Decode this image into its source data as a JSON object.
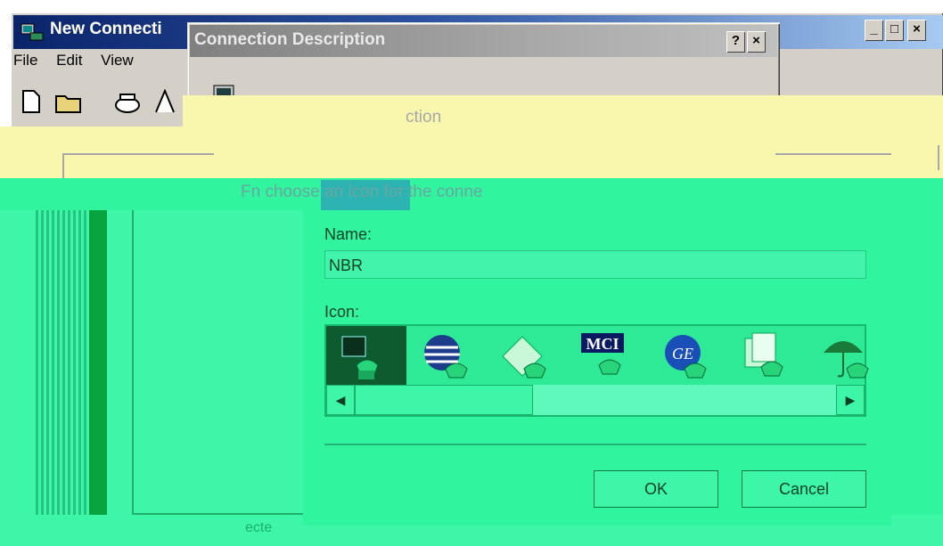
{
  "main_window": {
    "title": "New Connecti",
    "menu": [
      "File",
      "Edit",
      "View"
    ],
    "toolbar": [
      "new-file-icon",
      "open-folder-icon",
      "phone-icon",
      "dial-icon"
    ],
    "controls": {
      "minimize": "_",
      "maximize": "□",
      "close": "×"
    }
  },
  "dialog": {
    "title": "Connection Description",
    "help_label": "?",
    "close_label": "×",
    "header_text": "ction",
    "instruction": "Fn   choose an icon for the conne",
    "name_label": "Name:",
    "name_value": "NBR",
    "icon_label": "Icon:",
    "icons": [
      {
        "name": "phone-classic-icon",
        "selected": true
      },
      {
        "name": "globe-icon",
        "selected": false
      },
      {
        "name": "fax-icon",
        "selected": false
      },
      {
        "name": "mci-icon",
        "label": "MCI",
        "selected": false
      },
      {
        "name": "ge-icon",
        "label": "GE",
        "selected": false
      },
      {
        "name": "documents-icon",
        "selected": false
      },
      {
        "name": "umbrella-icon",
        "selected": false
      }
    ],
    "ok_label": "OK",
    "cancel_label": "Cancel"
  },
  "status_text": "ecte",
  "colors": {
    "title_active": "#0a246a",
    "title_inactive": "#808080",
    "window_face": "#d4d0c8",
    "overlay_yellow": "#f9f7ad",
    "overlay_green": "#30f59e",
    "selected_icon_bg": "#0d5b2f"
  }
}
